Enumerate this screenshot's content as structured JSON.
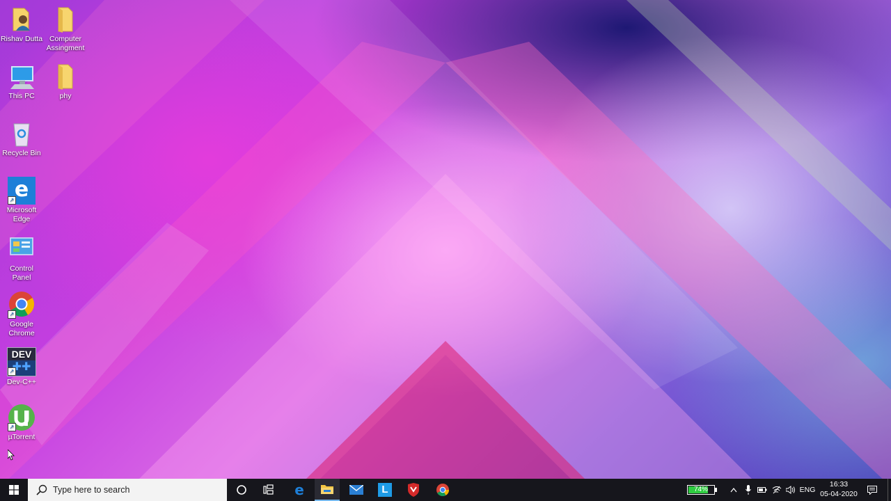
{
  "desktop": {
    "icons": [
      {
        "name": "Rishav Dutta",
        "icon": "user-folder-icon"
      },
      {
        "name": "Computer Assingment",
        "icon": "folder-icon"
      },
      {
        "name": "This PC",
        "icon": "computer-icon"
      },
      {
        "name": "phy",
        "icon": "folder-icon"
      },
      {
        "name": "Recycle Bin",
        "icon": "recycle-bin-icon"
      },
      {
        "name": "Microsoft Edge",
        "icon": "edge-icon"
      },
      {
        "name": "Control Panel",
        "icon": "control-panel-icon"
      },
      {
        "name": "Google Chrome",
        "icon": "chrome-icon"
      },
      {
        "name": "Dev-C++",
        "icon": "devcpp-icon"
      },
      {
        "name": "µTorrent",
        "icon": "utorrent-icon"
      }
    ],
    "devcpp_logo_text": "DEV",
    "edge_logo_text": "e"
  },
  "taskbar": {
    "search_placeholder": "Type here to search",
    "pinned": [
      "cortana-icon",
      "task-view-icon",
      "edge-icon",
      "file-explorer-icon",
      "mail-icon",
      "l-app-icon",
      "mcafee-icon",
      "chrome-icon"
    ],
    "l_app_letter": "L",
    "battery_percent": "74%",
    "language": "ENG",
    "time": "16:33",
    "date": "05-04-2020"
  },
  "colors": {
    "taskbar_bg": "#16161c",
    "battery_green": "#2ecc40",
    "edge_blue": "#1e7fd8",
    "explorer_yellow": "#f4c542",
    "mail_blue": "#2a7fd4",
    "mcafee_red": "#d42a2a"
  }
}
